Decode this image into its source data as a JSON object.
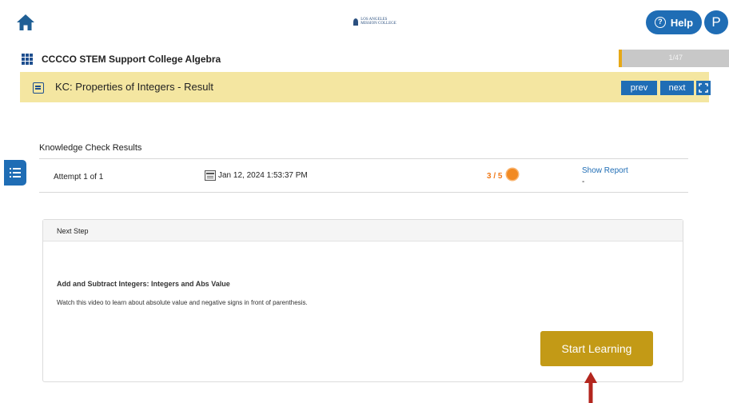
{
  "header": {
    "home_icon": "home-icon",
    "logo_text": "LOS ANGELES MISSION COLLEGE",
    "help_label": "Help",
    "avatar_initial": "P"
  },
  "course": {
    "title": "CCCCO STEM Support College Algebra",
    "progress_label": "1/47",
    "progress_fraction": 0.0213
  },
  "kc": {
    "title": "KC: Properties of Integers - Result",
    "prev_label": "prev",
    "next_label": "next"
  },
  "results": {
    "heading": "Knowledge Check Results",
    "attempt": "Attempt 1 of 1",
    "date": "Jan 12, 2024 1:53:37 PM",
    "score": "3 / 5",
    "show_report": "Show Report",
    "dash": "-"
  },
  "next_step": {
    "heading": "Next Step",
    "title": "Add and Subtract Integers: Integers and Abs Value",
    "description": "Watch this video to learn about absolute value and negative signs in front of parenthesis.",
    "button": "Start Learning"
  },
  "colors": {
    "accent_blue": "#1f6db5",
    "kc_bar_bg": "#f4e6a1",
    "progress_fill": "#e6a817",
    "start_button": "#c39a16",
    "score_orange": "#f07a1a",
    "arrow_red": "#b3261e"
  }
}
